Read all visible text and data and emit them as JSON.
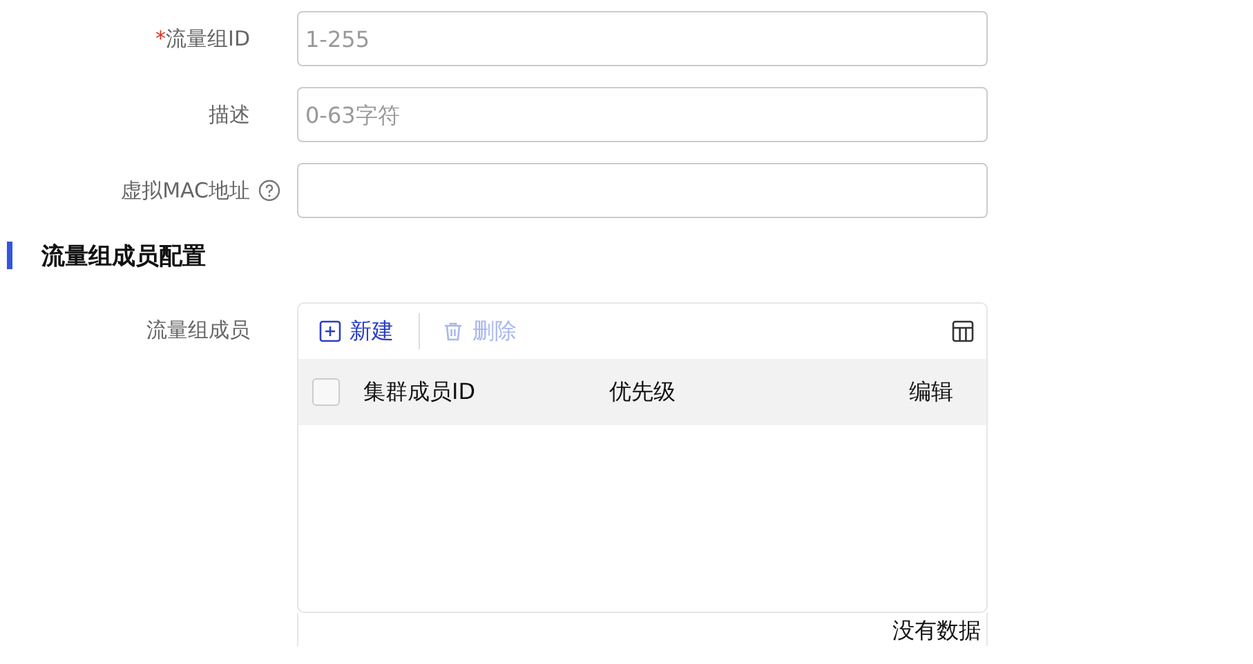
{
  "fields": [
    {
      "required_mark": "*",
      "label": "流量组ID",
      "placeholder": "1-255",
      "help": false
    },
    {
      "label": "描述",
      "placeholder": "0-63字符",
      "help": false
    },
    {
      "label": "虚拟MAC地址",
      "help": true
    }
  ],
  "section": {
    "title": "流量组成员配置"
  },
  "members": {
    "label": "流量组成员",
    "toolbar": [
      {
        "kind": "add",
        "label": "新建",
        "disabled": false
      },
      {
        "kind": "delete",
        "label": "删除",
        "disabled": true
      }
    ],
    "table": {
      "select_all": {
        "checked": false
      },
      "columns": [
        "集群成员ID",
        "优先级",
        "编辑"
      ]
    },
    "empty_text": "没有数据"
  }
}
